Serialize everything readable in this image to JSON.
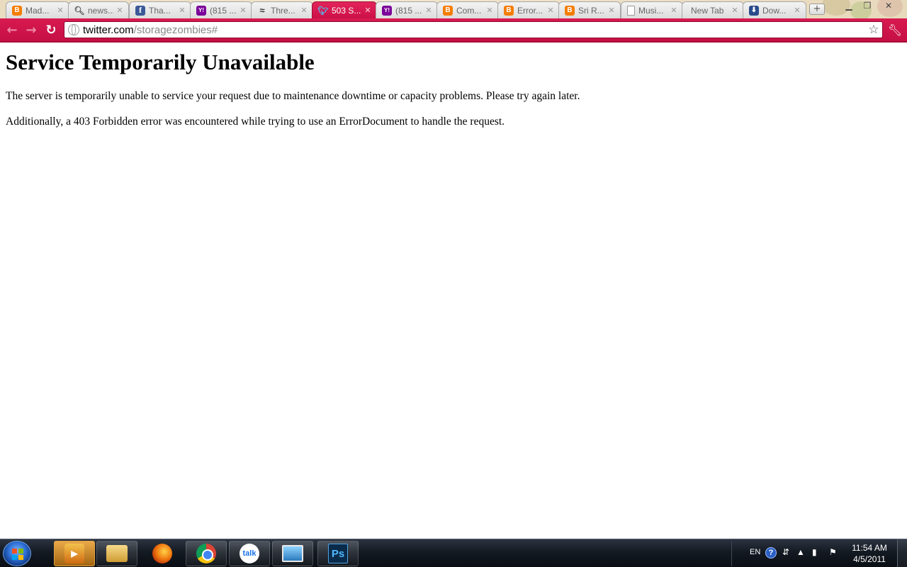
{
  "browser": {
    "tabs": [
      {
        "title": "Mad...",
        "favicon": "blogger-icon",
        "active": false
      },
      {
        "title": "news...",
        "favicon": "search-icon",
        "active": false
      },
      {
        "title": "Tha...",
        "favicon": "facebook-icon",
        "active": false
      },
      {
        "title": "(815 ...",
        "favicon": "yahoo-mail-icon",
        "active": false
      },
      {
        "title": "Thre...",
        "favicon": "wave-icon",
        "active": false
      },
      {
        "title": "503 S...",
        "favicon": "twitter-bird-icon",
        "active": true
      },
      {
        "title": "(815 ...",
        "favicon": "yahoo-mail-icon",
        "active": false
      },
      {
        "title": "Com...",
        "favicon": "blogger-icon",
        "active": false
      },
      {
        "title": "Error...",
        "favicon": "blogger-icon",
        "active": false
      },
      {
        "title": "Sri R...",
        "favicon": "blogger-icon",
        "active": false
      },
      {
        "title": "Musi...",
        "favicon": "page-icon",
        "active": false
      },
      {
        "title": "New Tab",
        "favicon": "",
        "active": false
      },
      {
        "title": "Dow...",
        "favicon": "download-icon",
        "active": false
      }
    ],
    "address_bar": {
      "host": "twitter.com",
      "path": "/storagezombies#"
    },
    "accent_color": "#d0144c"
  },
  "page": {
    "heading": "Service Temporarily Unavailable",
    "paragraph1": "The server is temporarily unable to service your request due to maintenance downtime or capacity problems. Please try again later.",
    "paragraph2": "Additionally, a 403 Forbidden error was encountered while trying to use an ErrorDocument to handle the request."
  },
  "taskbar": {
    "apps": [
      {
        "name": "windows-media-player-icon",
        "label": "",
        "active": true
      },
      {
        "name": "windows-explorer-icon",
        "label": "",
        "active": false
      },
      {
        "name": "firefox-icon",
        "label": "",
        "active": false
      },
      {
        "name": "chrome-icon",
        "label": "",
        "active": false
      },
      {
        "name": "google-talk-icon",
        "label": "talk",
        "active": false
      },
      {
        "name": "photo-viewer-icon",
        "label": "",
        "active": false
      },
      {
        "name": "photoshop-icon",
        "label": "Ps",
        "active": false
      }
    ],
    "tray": {
      "language": "EN",
      "help": "?",
      "time": "11:54 AM",
      "date": "4/5/2011"
    }
  }
}
